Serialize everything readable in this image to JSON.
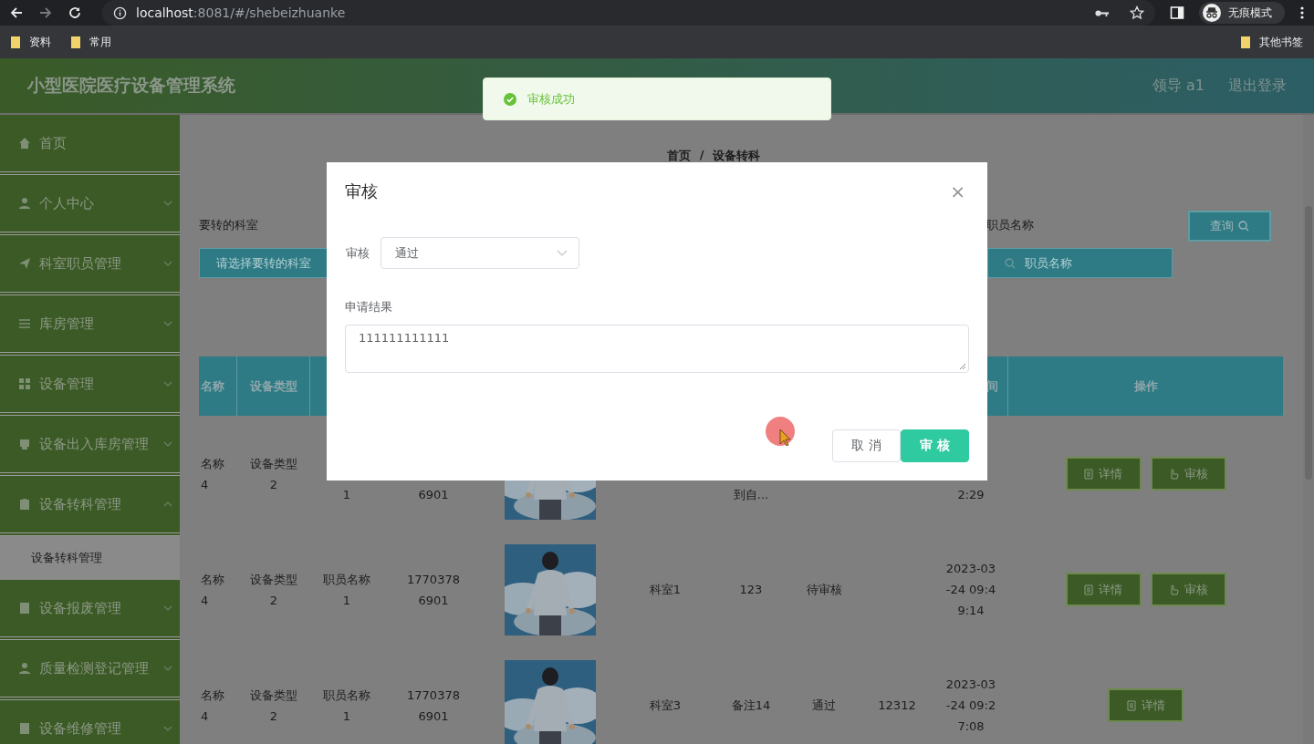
{
  "browser": {
    "url_host": "localhost",
    "url_rest": ":8081/#/shebeizhuanke",
    "profile": "无痕模式",
    "bookmarks": [
      "资料",
      "常用"
    ],
    "other_bookmarks": "其他书签"
  },
  "header": {
    "title": "小型医院医疗设备管理系统",
    "user": "领导 a1",
    "logout": "退出登录"
  },
  "toast": {
    "text": "审核成功"
  },
  "sidebar": {
    "items": [
      {
        "label": "首页",
        "kind": "link"
      },
      {
        "label": "个人中心",
        "kind": "menu",
        "expanded": false
      },
      {
        "label": "科室职员管理",
        "kind": "menu",
        "expanded": false
      },
      {
        "label": "库房管理",
        "kind": "menu",
        "expanded": false
      },
      {
        "label": "设备管理",
        "kind": "menu",
        "expanded": false
      },
      {
        "label": "设备出入库房管理",
        "kind": "menu",
        "expanded": false
      },
      {
        "label": "设备转科管理",
        "kind": "menu",
        "expanded": true,
        "children": [
          {
            "label": "设备转科管理",
            "selected": true
          }
        ]
      },
      {
        "label": "设备报废管理",
        "kind": "menu",
        "expanded": false
      },
      {
        "label": "质量检测登记管理",
        "kind": "menu",
        "expanded": false
      },
      {
        "label": "设备维修管理",
        "kind": "menu",
        "expanded": false
      }
    ]
  },
  "breadcrumb": {
    "items": [
      "首页",
      "设备转科"
    ],
    "separator": "/"
  },
  "search": {
    "fields": [
      {
        "label": "要转的科室",
        "placeholder": "请选择要转的科室",
        "kind": "select"
      },
      {
        "label": "职员名称",
        "placeholder": "职员名称",
        "kind": "input"
      }
    ],
    "button": "查询"
  },
  "table": {
    "columns": [
      "名称",
      "设备类型",
      null,
      null,
      null,
      null,
      null,
      null,
      null,
      "间",
      "操作"
    ],
    "rows": [
      {
        "cells": [
          {
            "kind": "text",
            "lines": [
              "名称",
              "4"
            ]
          },
          {
            "kind": "text",
            "lines": [
              "设备类型",
              "2"
            ]
          },
          {
            "kind": "text",
            "lines": [
              "1"
            ],
            "cut": true
          },
          {
            "kind": "text",
            "lines": [
              "6901"
            ],
            "cut": true
          },
          {
            "kind": "picture"
          },
          null,
          {
            "kind": "text",
            "lines": [
              "到自..."
            ],
            "cut": true
          },
          null,
          null,
          {
            "kind": "text",
            "lines": [
              "2:29"
            ],
            "cut": true
          },
          {
            "kind": "actions",
            "buttons": [
              {
                "label": "详情",
                "kind": "detail"
              },
              {
                "label": "审核",
                "kind": "review"
              }
            ]
          }
        ]
      },
      {
        "cells": [
          {
            "kind": "text",
            "lines": [
              "名称",
              "4"
            ]
          },
          {
            "kind": "text",
            "lines": [
              "设备类型",
              "2"
            ]
          },
          {
            "kind": "text",
            "lines": [
              "职员名称",
              "1"
            ]
          },
          {
            "kind": "text",
            "lines": [
              "1770378",
              "6901"
            ]
          },
          {
            "kind": "picture"
          },
          {
            "kind": "text",
            "lines": [
              "科室1"
            ]
          },
          {
            "kind": "text",
            "lines": [
              "123"
            ]
          },
          {
            "kind": "text",
            "lines": [
              "待审核"
            ]
          },
          null,
          {
            "kind": "text",
            "lines": [
              "2023-03",
              "-24 09:4",
              "9:14"
            ]
          },
          {
            "kind": "actions",
            "buttons": [
              {
                "label": "详情",
                "kind": "detail"
              },
              {
                "label": "审核",
                "kind": "review"
              }
            ]
          }
        ]
      },
      {
        "cells": [
          {
            "kind": "text",
            "lines": [
              "名称",
              "4"
            ]
          },
          {
            "kind": "text",
            "lines": [
              "设备类型",
              "2"
            ]
          },
          {
            "kind": "text",
            "lines": [
              "职员名称",
              "1"
            ]
          },
          {
            "kind": "text",
            "lines": [
              "1770378",
              "6901"
            ]
          },
          {
            "kind": "picture"
          },
          {
            "kind": "text",
            "lines": [
              "科室3"
            ]
          },
          {
            "kind": "text",
            "lines": [
              "备注14"
            ]
          },
          {
            "kind": "text",
            "lines": [
              "通过"
            ]
          },
          {
            "kind": "text",
            "lines": [
              "12312"
            ]
          },
          {
            "kind": "text",
            "lines": [
              "2023-03",
              "-24 09:2",
              "7:08"
            ]
          },
          {
            "kind": "actions",
            "buttons": [
              {
                "label": "详情",
                "kind": "detail"
              }
            ]
          }
        ]
      }
    ]
  },
  "dialog": {
    "title": "审核",
    "close": "×",
    "fields": [
      {
        "label": "审核",
        "kind": "select",
        "value": "通过"
      },
      {
        "label": "申请结果",
        "kind": "textarea",
        "value": "111111111111"
      }
    ],
    "buttons": [
      {
        "label": "取 消",
        "kind": "default"
      },
      {
        "label": "审 核",
        "kind": "primary"
      }
    ]
  }
}
